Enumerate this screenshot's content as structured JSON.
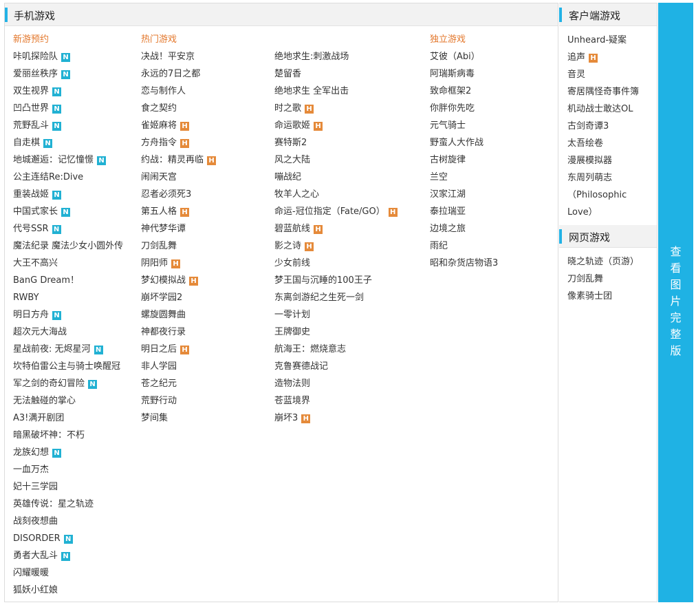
{
  "main": {
    "title": "手机游戏",
    "columns": [
      {
        "head": "新游预约",
        "items": [
          {
            "label": "咔叽探险队",
            "badge": "N"
          },
          {
            "label": "爱丽丝秩序",
            "badge": "N"
          },
          {
            "label": "双生视界",
            "badge": "N"
          },
          {
            "label": "凹凸世界",
            "badge": "N"
          },
          {
            "label": "荒野乱斗",
            "badge": "N"
          },
          {
            "label": "自走棋",
            "badge": "N"
          },
          {
            "label": "地城邂逅：记忆憧憬",
            "badge": "N"
          },
          {
            "label": "公主连结Re:Dive",
            "badge": ""
          },
          {
            "label": "重装战姬",
            "badge": "N"
          },
          {
            "label": "中国式家长",
            "badge": "N"
          },
          {
            "label": "代号SSR",
            "badge": "N"
          },
          {
            "label": "魔法纪录 魔法少女小圆外传",
            "badge": ""
          },
          {
            "label": "大王不高兴",
            "badge": ""
          },
          {
            "label": "BanG Dream！",
            "badge": ""
          },
          {
            "label": "RWBY",
            "badge": ""
          },
          {
            "label": "明日方舟",
            "badge": "N"
          },
          {
            "label": "超次元大海战",
            "badge": ""
          },
          {
            "label": "星战前夜: 无烬星河",
            "badge": "N"
          },
          {
            "label": "坎特伯雷公主与骑士唤醒冠",
            "badge": ""
          },
          {
            "label": "军之剑的奇幻冒险",
            "badge": "N"
          },
          {
            "label": "无法触碰的掌心",
            "badge": ""
          },
          {
            "label": "A3!满开剧团",
            "badge": ""
          },
          {
            "label": "暗黑破坏神：不朽",
            "badge": ""
          },
          {
            "label": "龙族幻想",
            "badge": "N"
          },
          {
            "label": "一血万杰",
            "badge": ""
          },
          {
            "label": "妃十三学园",
            "badge": ""
          },
          {
            "label": "英雄传说：星之轨迹",
            "badge": ""
          },
          {
            "label": "战刻夜想曲",
            "badge": ""
          },
          {
            "label": "DISORDER",
            "badge": "N"
          },
          {
            "label": "勇者大乱斗",
            "badge": "N"
          },
          {
            "label": "闪耀暖暖",
            "badge": ""
          },
          {
            "label": "狐妖小红娘",
            "badge": ""
          }
        ]
      },
      {
        "head": "热门游戏",
        "items": [
          {
            "label": "决战！平安京",
            "badge": ""
          },
          {
            "label": "永远的7日之都",
            "badge": ""
          },
          {
            "label": "恋与制作人",
            "badge": ""
          },
          {
            "label": "食之契约",
            "badge": ""
          },
          {
            "label": "雀姬麻将",
            "badge": "H"
          },
          {
            "label": "方舟指令",
            "badge": "H"
          },
          {
            "label": "约战：精灵再临",
            "badge": "H"
          },
          {
            "label": "闹闹天宫",
            "badge": ""
          },
          {
            "label": "忍者必须死3",
            "badge": ""
          },
          {
            "label": "第五人格",
            "badge": "H"
          },
          {
            "label": "神代梦华谭",
            "badge": ""
          },
          {
            "label": "刀剑乱舞",
            "badge": ""
          },
          {
            "label": "阴阳师",
            "badge": "H"
          },
          {
            "label": "梦幻模拟战",
            "badge": "H"
          },
          {
            "label": "崩坏学园2",
            "badge": ""
          },
          {
            "label": "螺旋圆舞曲",
            "badge": ""
          },
          {
            "label": "神都夜行录",
            "badge": ""
          },
          {
            "label": "明日之后",
            "badge": "H"
          },
          {
            "label": "非人学园",
            "badge": ""
          },
          {
            "label": "苍之纪元",
            "badge": ""
          },
          {
            "label": "荒野行动",
            "badge": ""
          },
          {
            "label": "梦间集",
            "badge": ""
          }
        ]
      },
      {
        "head": "",
        "items": [
          {
            "label": "绝地求生:刺激战场",
            "badge": ""
          },
          {
            "label": "楚留香",
            "badge": ""
          },
          {
            "label": "绝地求生 全军出击",
            "badge": ""
          },
          {
            "label": "时之歌",
            "badge": "H"
          },
          {
            "label": "命运歌姬",
            "badge": "H"
          },
          {
            "label": "赛特斯2",
            "badge": ""
          },
          {
            "label": "风之大陆",
            "badge": ""
          },
          {
            "label": "嘣战纪",
            "badge": ""
          },
          {
            "label": "牧羊人之心",
            "badge": ""
          },
          {
            "label": "命运-冠位指定（Fate/GO）",
            "badge": "H"
          },
          {
            "label": "碧蓝航线",
            "badge": "H"
          },
          {
            "label": "影之诗",
            "badge": "H"
          },
          {
            "label": "少女前线",
            "badge": ""
          },
          {
            "label": "梦王国与沉睡的100王子",
            "badge": ""
          },
          {
            "label": "东离剑游纪之生死一剑",
            "badge": ""
          },
          {
            "label": "一零计划",
            "badge": ""
          },
          {
            "label": "王牌御史",
            "badge": ""
          },
          {
            "label": "航海王：燃烧意志",
            "badge": ""
          },
          {
            "label": "克鲁赛德战记",
            "badge": ""
          },
          {
            "label": "造物法则",
            "badge": ""
          },
          {
            "label": "苍蓝境界",
            "badge": ""
          },
          {
            "label": "崩坏3",
            "badge": "H"
          }
        ]
      },
      {
        "head": "独立游戏",
        "items": [
          {
            "label": "艾彼（Abi）",
            "badge": ""
          },
          {
            "label": "阿瑞斯病毒",
            "badge": ""
          },
          {
            "label": "致命框架2",
            "badge": ""
          },
          {
            "label": "你胖你先吃",
            "badge": ""
          },
          {
            "label": "元气骑士",
            "badge": ""
          },
          {
            "label": "野蛮人大作战",
            "badge": ""
          },
          {
            "label": "古树旋律",
            "badge": ""
          },
          {
            "label": "兰空",
            "badge": ""
          },
          {
            "label": "汉家江湖",
            "badge": ""
          },
          {
            "label": "泰拉瑞亚",
            "badge": ""
          },
          {
            "label": "边境之旅",
            "badge": ""
          },
          {
            "label": "雨纪",
            "badge": ""
          },
          {
            "label": "昭和杂货店物语3",
            "badge": ""
          }
        ]
      }
    ]
  },
  "client": {
    "title": "客户端游戏",
    "items": [
      {
        "label": "Unheard-疑案",
        "badge": ""
      },
      {
        "label": "追声",
        "badge": "H"
      },
      {
        "label": "音灵",
        "badge": ""
      },
      {
        "label": "寄居隅怪奇事件簿",
        "badge": ""
      },
      {
        "label": "机动战士敢达OL",
        "badge": ""
      },
      {
        "label": "古剑奇谭3",
        "badge": ""
      },
      {
        "label": "太吾绘卷",
        "badge": ""
      },
      {
        "label": "漫展模拟器",
        "badge": ""
      },
      {
        "label": "东周列萌志",
        "badge": ""
      },
      {
        "label": "（Philosophic",
        "badge": ""
      },
      {
        "label": "Love）",
        "badge": ""
      }
    ]
  },
  "web": {
    "title": "网页游戏",
    "items": [
      {
        "label": "晓之轨迹（页游）",
        "badge": ""
      },
      {
        "label": "刀剑乱舞",
        "badge": ""
      },
      {
        "label": "像素骑士团",
        "badge": ""
      }
    ]
  },
  "view_full": [
    "查",
    "看",
    "图",
    "片",
    "完",
    "整",
    "版"
  ],
  "colors": {
    "accent": "#1fb2e4",
    "badge_new": "#21b1d3",
    "badge_hot": "#e58a3a",
    "column_head": "#e3772b"
  }
}
